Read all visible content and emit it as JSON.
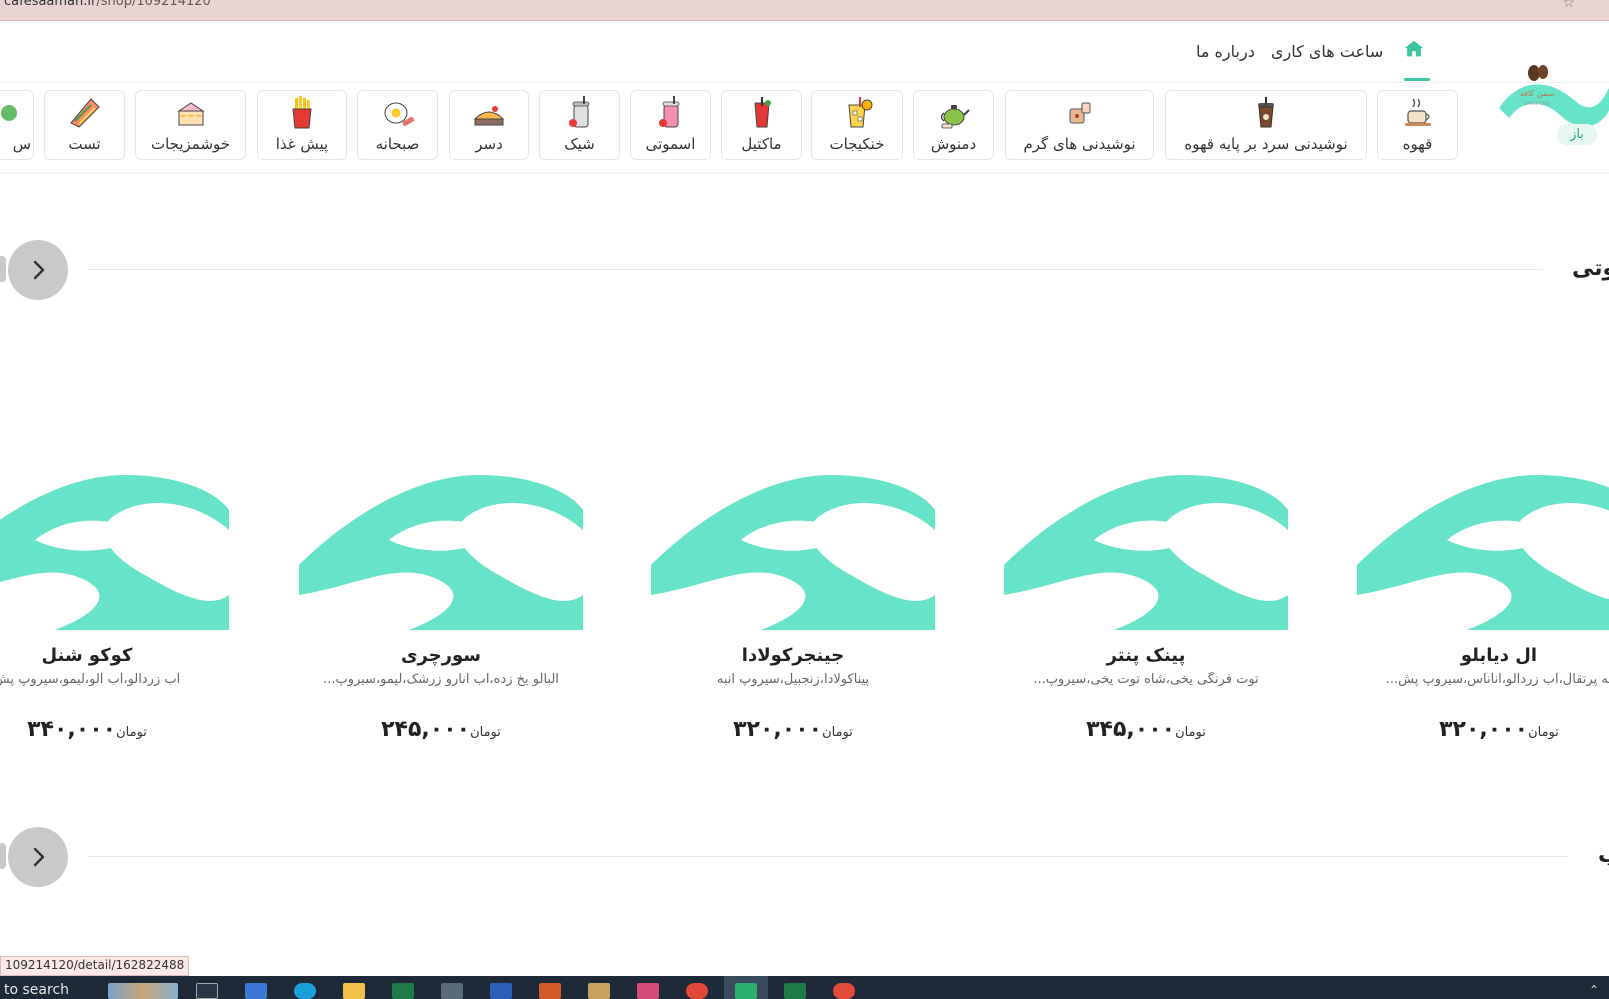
{
  "browser": {
    "url": "cafesaaman.ir/shop/109214120",
    "url_domain": "cafesaaman.ir",
    "url_path": "/shop/109214120",
    "bookmark_icon": "star-icon"
  },
  "header": {
    "logo_text": "سمن کافه",
    "logo_subtext": "SAMAN CAFE",
    "status": "باز",
    "home_icon": "home-icon",
    "nav_links": [
      "ساعت های کاری",
      "درباره ما"
    ]
  },
  "categories": [
    {
      "label": "قهوه",
      "icon": "coffee-cup-icon"
    },
    {
      "label": "نوشیدنی سرد بر پایه قهوه",
      "icon": "iced-coffee-icon"
    },
    {
      "label": "نوشیدنی های گرم",
      "icon": "hot-drink-icon"
    },
    {
      "label": "دمنوش",
      "icon": "teapot-icon"
    },
    {
      "label": "خنکیجات",
      "icon": "cold-drink-icon"
    },
    {
      "label": "ماکتیل",
      "icon": "mocktail-icon"
    },
    {
      "label": "اسموتی",
      "icon": "smoothie-icon"
    },
    {
      "label": "شیک",
      "icon": "shake-icon"
    },
    {
      "label": "دسر",
      "icon": "dessert-icon"
    },
    {
      "label": "صبحانه",
      "icon": "breakfast-icon"
    },
    {
      "label": "پیش غذا",
      "icon": "fries-icon"
    },
    {
      "label": "خوشمزیجات",
      "icon": "cake-icon"
    },
    {
      "label": "تست",
      "icon": "toast-icon"
    },
    {
      "label": "س",
      "icon": "partial-icon"
    }
  ],
  "section1": {
    "title": "وتی"
  },
  "section2": {
    "title": "ب"
  },
  "products": [
    {
      "name": "ال دیابلو",
      "desc": "له پرتقال،آب زردآلو،آناناس،سیروپ پش...",
      "price": "۳۲۰,۰۰۰",
      "currency": "تومان"
    },
    {
      "name": "پینک پنتر",
      "desc": "توت فرنگی یخی،شاه توت یخی،سیروپ...",
      "price": "۳۴۵,۰۰۰",
      "currency": "تومان"
    },
    {
      "name": "جینجرکولادا",
      "desc": "پیناکولادا،زنجبیل،سیروپ انبه",
      "price": "۳۲۰,۰۰۰",
      "currency": "تومان"
    },
    {
      "name": "سورچری",
      "desc": "آلبالو یخ زده،آب انارو زرشک،لیمو،سیروپ...",
      "price": "۲۴۵,۰۰۰",
      "currency": "تومان"
    },
    {
      "name": "کوکو شنل",
      "desc": "آب زردالو،آب آلو،لیمو،سیروپ پش",
      "price": "۳۴۰,۰۰۰",
      "currency": "تومان"
    }
  ],
  "status_link": "109214120/detail/162822488",
  "taskbar": {
    "search_text": "to search"
  },
  "colors": {
    "accent": "#3cc5a0",
    "placeholder": "#66e3c9",
    "arrow_button": "#c9c9c9"
  }
}
